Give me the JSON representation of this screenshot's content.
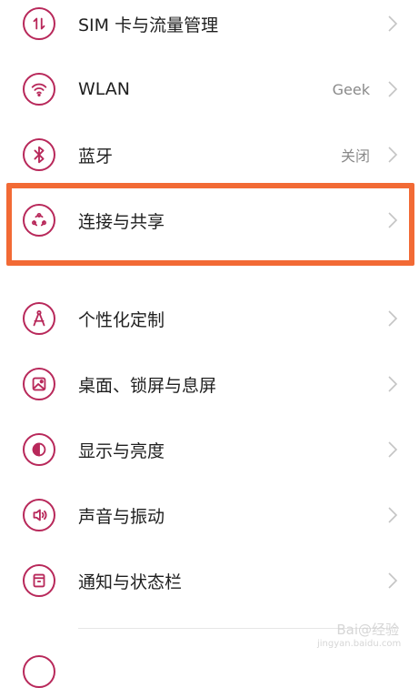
{
  "colors": {
    "accent": "#b8285a",
    "highlight": "#f26a35"
  },
  "settings": [
    {
      "label": "SIM 卡与流量管理",
      "value": "",
      "icon": "sim-traffic-icon"
    },
    {
      "label": "WLAN",
      "value": "Geek",
      "icon": "wifi-icon"
    },
    {
      "label": "蓝牙",
      "value": "关闭",
      "icon": "bluetooth-icon"
    },
    {
      "label": "连接与共享",
      "value": "",
      "icon": "share-connection-icon"
    },
    {
      "label": "个性化定制",
      "value": "",
      "icon": "compass-icon"
    },
    {
      "label": "桌面、锁屏与息屏",
      "value": "",
      "icon": "wallpaper-icon"
    },
    {
      "label": "显示与亮度",
      "value": "",
      "icon": "brightness-icon"
    },
    {
      "label": "声音与振动",
      "value": "",
      "icon": "sound-icon"
    },
    {
      "label": "通知与状态栏",
      "value": "",
      "icon": "notification-icon"
    }
  ],
  "watermark": {
    "line1": "Bai@经验",
    "line2": "jingyan.baidu.com"
  }
}
